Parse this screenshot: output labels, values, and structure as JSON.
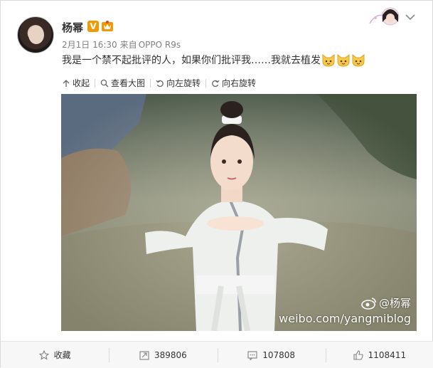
{
  "user": {
    "name": "杨幂",
    "verified_badge": "V",
    "timestamp": "2月1日 16:30",
    "source_prefix": "来自",
    "source_device": "OPPO R9s"
  },
  "post": {
    "text": "我是一个禁不起批评的人，如果你们批评我……我就去植发",
    "emoji_count": 3,
    "emoji_icon": "cat-emoji-icon"
  },
  "image_toolbar": {
    "collapse": "收起",
    "view_large": "查看大图",
    "rotate_left": "向左旋转",
    "rotate_right": "向右旋转"
  },
  "photo": {
    "watermark_name": "@杨幂",
    "watermark_url": "weibo.com/yangmiblog"
  },
  "footer": {
    "favorite": "收藏",
    "repost_count": "389806",
    "comment_count": "107808",
    "like_count": "1108411"
  },
  "colors": {
    "accent_orange": "#f39800",
    "text": "#333333",
    "meta": "#808080",
    "footer_bg": "#f7f7f7"
  }
}
